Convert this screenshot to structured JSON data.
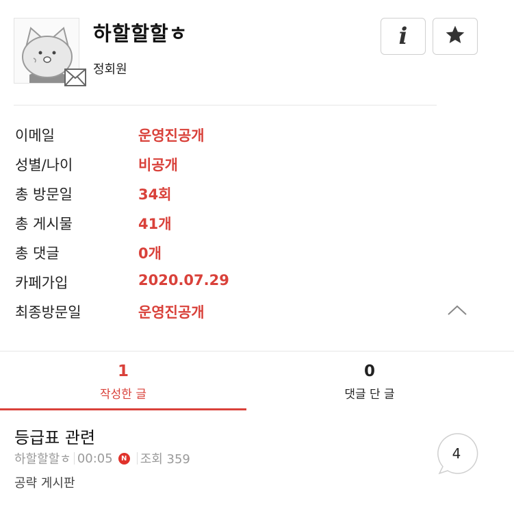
{
  "profile": {
    "nickname": "하할할할ㅎ",
    "level": "정회원",
    "avatar_icon": "cat-avatar-icon",
    "mail_icon": "envelope-icon"
  },
  "actions": {
    "info_label": "i",
    "info_icon": "info-icon",
    "star_icon": "star-icon"
  },
  "info": [
    {
      "label": "이메일",
      "value": "운영진공개"
    },
    {
      "label": "성별/나이",
      "value": "비공개"
    },
    {
      "label": "총 방문일",
      "value": "34회"
    },
    {
      "label": "총 게시물",
      "value": "41개"
    },
    {
      "label": "총 댓글",
      "value": "0개"
    },
    {
      "label": "카페가입",
      "value": "2020.07.29"
    },
    {
      "label": "최종방문일",
      "value": "운영진공개"
    }
  ],
  "collapse_icon": "chevron-up-icon",
  "tabs": [
    {
      "count": "1",
      "label": "작성한 글",
      "active": true
    },
    {
      "count": "0",
      "label": "댓글 단 글",
      "active": false
    }
  ],
  "posts": [
    {
      "title": "등급표 관련",
      "author": "하할할할ㅎ",
      "time": "00:05",
      "new_badge": "N",
      "views": "조회 359",
      "board": "공략 게시판",
      "comment_count": "4"
    }
  ],
  "colors": {
    "accent": "#d9413a",
    "muted": "#9a9a9a",
    "divider": "#e6e6e6"
  }
}
